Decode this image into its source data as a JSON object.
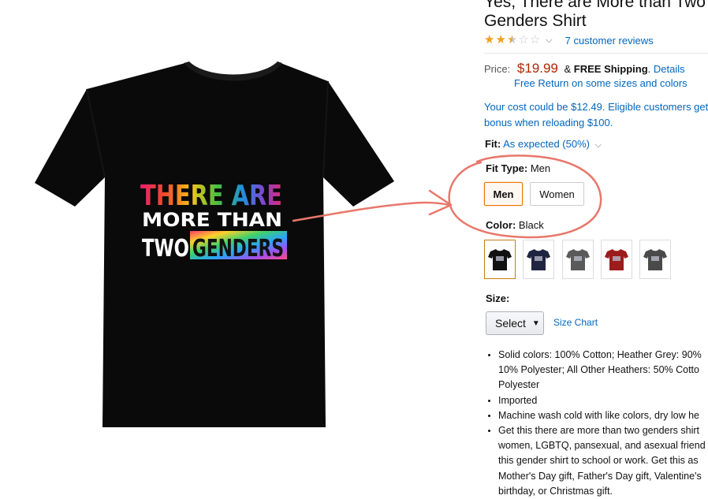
{
  "product": {
    "title_line1": "Yes, There are More than Two",
    "title_line2": "Genders Shirt",
    "rating_stars": 2.5,
    "reviews_link": "7 customer reviews",
    "price_label": "Price:",
    "price": "$19.99",
    "amp": "&",
    "free_shipping": "FREE Shipping",
    "shipping_period": ".",
    "details_link": "Details",
    "free_return": "Free Return on some sizes and colors",
    "cost_line1": "Your cost could be $12.49. Eligible customers get",
    "cost_line2": "bonus when reloading $100.",
    "fit_label": "Fit:",
    "fit_value": "As expected (50%)",
    "fit_type_label": "Fit Type:",
    "fit_type_value": "Men",
    "fit_options": [
      "Men",
      "Women"
    ],
    "color_label": "Color:",
    "color_value": "Black",
    "color_swatches": [
      "#111111",
      "#1f2440",
      "#5a5a5a",
      "#9c1c1c",
      "#4a4a4a"
    ],
    "size_label": "Size:",
    "size_select": "Select",
    "size_chart_link": "Size Chart",
    "bullets": [
      [
        "Solid colors: 100% Cotton; Heather Grey: 90%",
        "10% Polyester; All Other Heathers: 50% Cotto",
        "Polyester"
      ],
      [
        "Imported"
      ],
      [
        "Machine wash cold with like colors, dry low he"
      ],
      [
        "Get this there are more than two genders shirt",
        "women, LGBTQ, pansexual, and asexual friend",
        "this gender shirt to school or work. Get this as",
        "Mother's Day gift, Father's Day gift, Valentine's",
        "birthday, or Christmas gift."
      ]
    ]
  },
  "shirt_print": {
    "line1": "THERE ARE",
    "line2": "MORE THAN",
    "line3a": "TWO",
    "line3b": "GENDERS"
  },
  "colors": {
    "price": "#B12704",
    "link": "#0066c0",
    "star": "#f0a01a",
    "annotation": "#e8776b",
    "selected_border": "#e77600"
  }
}
